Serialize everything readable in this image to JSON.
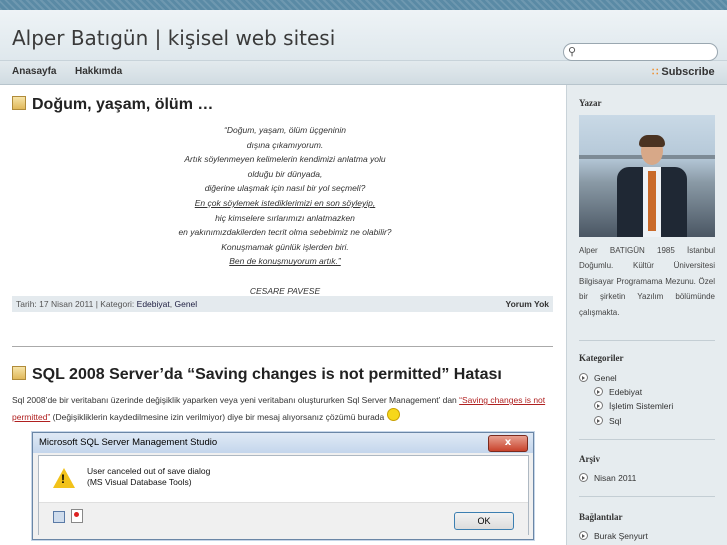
{
  "header": {
    "site_title": "Alper Batıgün | kişisel web sitesi",
    "search_placeholder": ""
  },
  "nav": {
    "items": [
      "Anasayfa",
      "Hakkımda"
    ],
    "subscribe": "Subscribe"
  },
  "post1": {
    "title": "Doğum, yaşam, ölüm …",
    "poem": [
      "“Doğum, yaşam, ölüm üçgeninin",
      "dışına çıkamıyorum.",
      "Artık söylenmeyen kelimelerin kendimizi anlatma yolu",
      "olduğu bir dünyada,",
      "diğerine ulaşmak için nasıl bir yol seçmeli?",
      "En çok söylemek istediklerimizi en son söyleyip,",
      "hiç kimselere sırlarımızı anlatmazken",
      "en yakınımızdakilerden tecrit olma sebebimiz ne olabilir?",
      "Konuşmamak günlük işlerden biri.",
      "Ben de konuşmuyorum artık.”",
      "",
      "CESARE PAVESE"
    ],
    "meta_prefix": "Tarih: 17 Nisan 2011 | Kategori: ",
    "cat1": "Edebiyat",
    "cat_sep": ", ",
    "cat2": "Genel",
    "comments": "Yorum Yok"
  },
  "post2": {
    "title": "SQL 2008 Server’da “Saving changes is not permitted” Hatası",
    "text1": "Sql 2008’de bir veritabanı üzerinde değişiklik yaparken veya yeni veritabanı oluştururken  Sql Server Management’ dan ",
    "link": "“Saving changes is not permitted”",
    "text2": " (Değişikliklerin kaydedilmesine izin verilmiyor)  diye bir mesaj alıyorsanız çözümü burada "
  },
  "dialog": {
    "title": "Microsoft SQL Server Management Studio",
    "close": "x",
    "line1": "User canceled out of save dialog",
    "line2": "(MS Visual Database Tools)",
    "ok": "OK"
  },
  "sidebar": {
    "author_heading": "Yazar",
    "bio": "Alper BATIGÜN 1985 İstanbul Doğumlu. Kültür Üniversitesi Bilgisayar Programama Mezunu. Özel bir şirketin Yazılım bölümünde çalışmakta.",
    "categories_heading": "Kategoriler",
    "categories": [
      "Genel",
      "Edebiyat",
      "İşletim Sistemleri",
      "Sql"
    ],
    "archive_heading": "Arşiv",
    "archive": [
      "Nisan 2011"
    ],
    "links_heading": "Bağlantılar",
    "links": [
      "Burak Şenyurt"
    ]
  }
}
